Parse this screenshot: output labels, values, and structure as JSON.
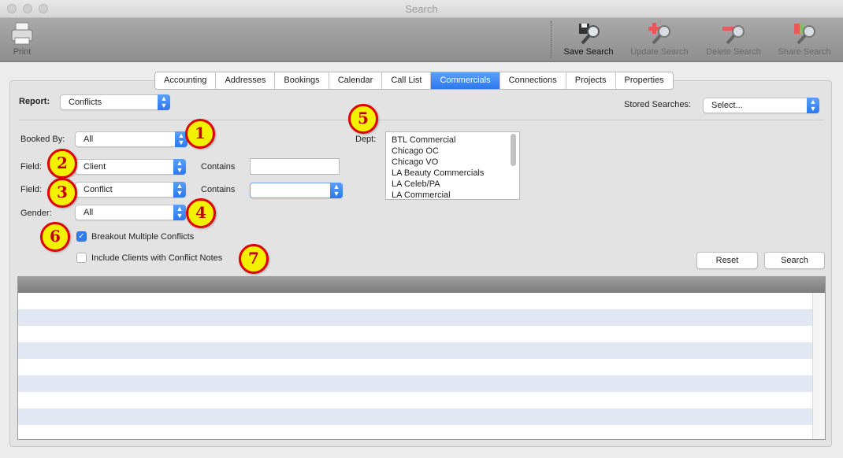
{
  "window": {
    "title": "Search"
  },
  "toolbar": {
    "print_label": "Print",
    "save_search_label": "Save Search",
    "update_search_label": "Update Search",
    "delete_search_label": "Delete Search",
    "share_search_label": "Share Search"
  },
  "tabs": [
    {
      "label": "Accounting"
    },
    {
      "label": "Addresses"
    },
    {
      "label": "Bookings"
    },
    {
      "label": "Calendar"
    },
    {
      "label": "Call List"
    },
    {
      "label": "Commercials",
      "active": true
    },
    {
      "label": "Connections"
    },
    {
      "label": "Projects"
    },
    {
      "label": "Properties"
    }
  ],
  "form": {
    "report_label": "Report:",
    "report_value": "Conflicts",
    "stored_searches_label": "Stored Searches:",
    "stored_searches_value": "Select...",
    "booked_by_label": "Booked By:",
    "booked_by_value": "All",
    "field1_label": "Field:",
    "field1_value": "Client",
    "contains1_label": "Contains",
    "contains1_value": "",
    "field2_label": "Field:",
    "field2_value": "Conflict",
    "contains2_label": "Contains",
    "contains2_value": "",
    "gender_label": "Gender:",
    "gender_value": "All",
    "dept_label": "Dept:",
    "dept_items": [
      "BTL Commercial",
      "Chicago OC",
      "Chicago VO",
      "LA Beauty Commercials",
      "LA Celeb/PA",
      "LA Commercial"
    ],
    "breakout_label": "Breakout Multiple Conflicts",
    "breakout_checked": true,
    "include_notes_label": "Include Clients with Conflict Notes",
    "include_notes_checked": false,
    "reset_label": "Reset",
    "search_label": "Search"
  },
  "annotations": [
    "1",
    "2",
    "3",
    "4",
    "5",
    "6",
    "7"
  ],
  "colors": {
    "accent": "#2c78ee",
    "badge_fill": "#f2f200",
    "badge_border": "#e00000",
    "row_stripe": "#e1e8f4"
  }
}
